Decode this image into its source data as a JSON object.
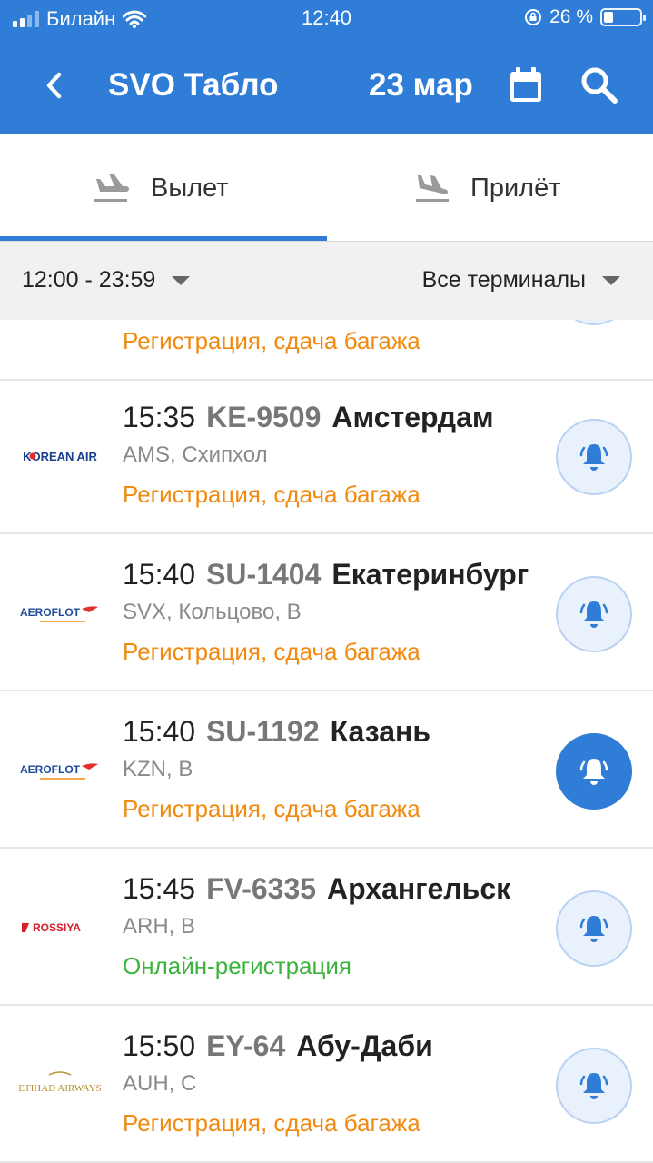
{
  "status_bar": {
    "carrier": "Билайн",
    "time": "12:40",
    "battery": "26 %",
    "battery_level": 0.26
  },
  "header": {
    "title": "SVO Табло",
    "date": "23 мар"
  },
  "tabs": [
    {
      "label": "Вылет",
      "active": true
    },
    {
      "label": "Прилёт",
      "active": false
    }
  ],
  "filters": {
    "time_range": "12:00 - 23:59",
    "terminal": "Все терминалы"
  },
  "colors": {
    "accent": "#2f7dd7",
    "status_orange": "#f08a10",
    "status_green": "#3cb33c"
  },
  "flights": [
    {
      "status": "Регистрация, сдача багажа",
      "status_color": "orange",
      "partial": true
    },
    {
      "time": "15:35",
      "flight": "KE-9509",
      "destination": "Амстердам",
      "airport": "AMS, Схипхол",
      "status": "Регистрация, сдача багажа",
      "status_color": "orange",
      "airline_logo": "KOREAN AIR",
      "subscribed": false
    },
    {
      "time": "15:40",
      "flight": "SU-1404",
      "destination": "Екатеринбург",
      "airport": "SVX, Кольцово, B",
      "status": "Регистрация, сдача багажа",
      "status_color": "orange",
      "airline_logo": "AEROFLOT",
      "subscribed": false
    },
    {
      "time": "15:40",
      "flight": "SU-1192",
      "destination": "Казань",
      "airport": "KZN, B",
      "status": "Регистрация, сдача багажа",
      "status_color": "orange",
      "airline_logo": "AEROFLOT",
      "subscribed": true
    },
    {
      "time": "15:45",
      "flight": "FV-6335",
      "destination": "Архангельск",
      "airport": "ARH, B",
      "status": "Онлайн-регистрация",
      "status_color": "green",
      "airline_logo": "ROSSIYA",
      "subscribed": false
    },
    {
      "time": "15:50",
      "flight": "EY-64",
      "destination": "Абу-Даби",
      "airport": "AUH, C",
      "status": "Регистрация, сдача багажа",
      "status_color": "orange",
      "airline_logo": "ETIHAD AIRWAYS",
      "subscribed": false
    }
  ]
}
